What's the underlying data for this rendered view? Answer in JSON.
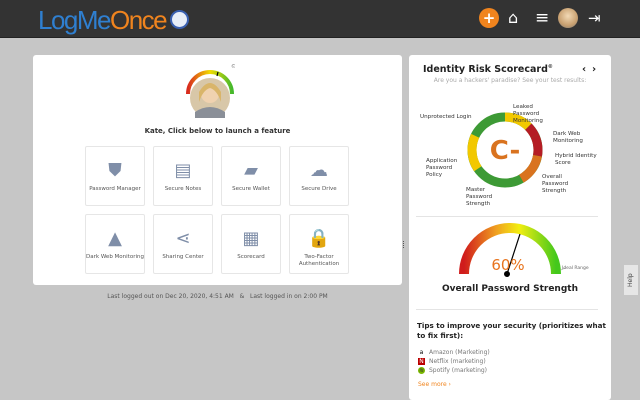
{
  "header": {
    "logo_part1": "LogMe",
    "logo_part2": "Once",
    "add_icon": "+",
    "home_icon": "⌂",
    "menu_icon": "≡",
    "logout_icon": "⇥"
  },
  "main": {
    "greeting": "Kate, Click below to launch a feature",
    "features": [
      {
        "label": "Password Manager",
        "icon": "shield-lock"
      },
      {
        "label": "Secure Notes",
        "icon": "note-lock"
      },
      {
        "label": "Secure Wallet",
        "icon": "wallet"
      },
      {
        "label": "Secure Drive",
        "icon": "cloud-lock"
      },
      {
        "label": "Dark Web Monitoring",
        "icon": "spy"
      },
      {
        "label": "Sharing Center",
        "icon": "share"
      },
      {
        "label": "Scorecard",
        "icon": "certificate"
      },
      {
        "label": "Two-Factor Authentication",
        "icon": "padlocks"
      }
    ],
    "last_logged_out": "Last logged out on Dec 20, 2020, 4:51 AM",
    "separator": "&",
    "last_logged_in": "Last logged in on 2:00 PM"
  },
  "scorecard": {
    "title": "Identity Risk Scorecard",
    "mark": "©",
    "subtitle": "Are you a hackers' paradise? See your test results:",
    "grade": "C-",
    "labels": {
      "leaked": "Leaked Password Monitoring",
      "darkweb": "Dark Web Monitoring",
      "hybrid": "Hybrid Identity Score",
      "overall": "Overall Password Strength",
      "master": "Master Password Strength",
      "app": "Application Password Policy",
      "unprotected": "Unprotected Login"
    },
    "colors": {
      "green": "#3d9a35",
      "yellow": "#f2c800",
      "red": "#b51c24",
      "orange": "#d9731f"
    }
  },
  "strength": {
    "percent_label": "60%",
    "value": 60,
    "ideal": "Ideal Range",
    "title": "Overall Password Strength"
  },
  "tips": {
    "heading": "Tips to improve your security (prioritizes what to fix first):",
    "items": [
      {
        "label": "Amazon (Marketing)",
        "icon": "a"
      },
      {
        "label": "Netflix (marketing)",
        "icon": "N"
      },
      {
        "label": "Spotify (marketing)",
        "icon": "≋"
      }
    ],
    "see_more": "See more ›"
  },
  "help": "Help"
}
